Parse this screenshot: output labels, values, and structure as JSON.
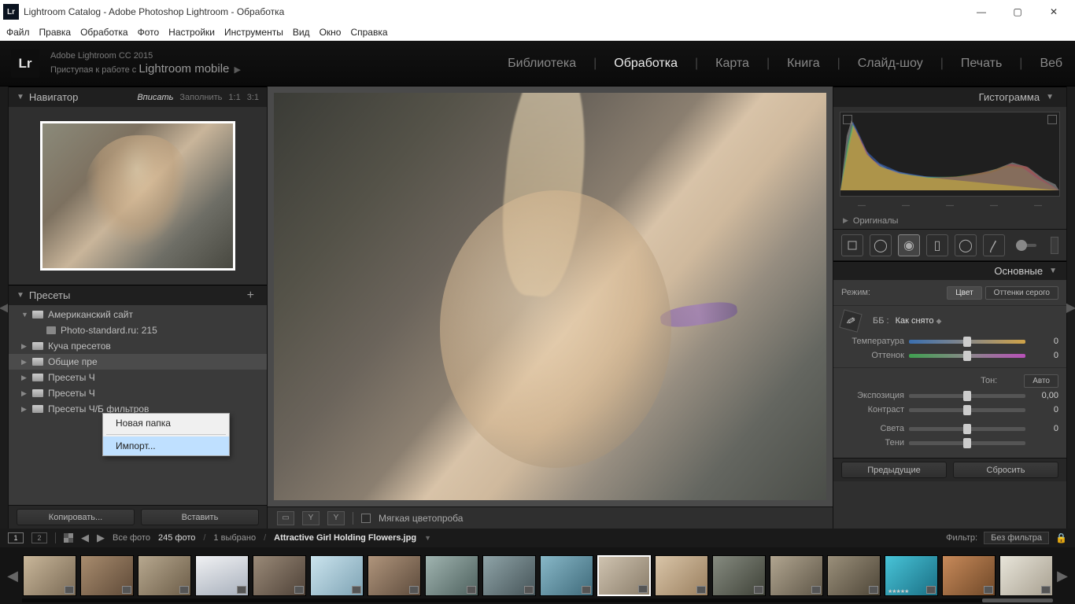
{
  "window": {
    "title": "Lightroom Catalog - Adobe Photoshop Lightroom - Обработка",
    "icon": "Lr"
  },
  "menubar": [
    "Файл",
    "Правка",
    "Обработка",
    "Фото",
    "Настройки",
    "Инструменты",
    "Вид",
    "Окно",
    "Справка"
  ],
  "brand": {
    "line1": "Adobe Lightroom CC 2015",
    "line2_pre": "Приступая к работе с ",
    "line2_big": "Lightroom mobile"
  },
  "modules": [
    "Библиотека",
    "Обработка",
    "Карта",
    "Книга",
    "Слайд-шоу",
    "Печать",
    "Веб"
  ],
  "modules_active_index": 1,
  "navigator": {
    "title": "Навигатор",
    "opts": [
      "Вписать",
      "Заполнить",
      "1:1",
      "3:1"
    ],
    "opts_sel": 0
  },
  "presets": {
    "title": "Пресеты",
    "tree": [
      {
        "label": "Американский сайт",
        "open": true
      },
      {
        "label": "Photo-standard.ru: 215",
        "sub": true
      },
      {
        "label": "Куча пресетов"
      },
      {
        "label": "Общие пре",
        "sel": true
      },
      {
        "label": "Пресеты Ч"
      },
      {
        "label": "Пресеты Ч"
      },
      {
        "label": "Пресеты Ч/Б фильтров"
      }
    ]
  },
  "ctxmenu": {
    "items": [
      "Новая папка",
      "Импорт..."
    ],
    "highlight_index": 1
  },
  "left_buttons": {
    "copy": "Копировать...",
    "paste": "Вставить"
  },
  "softproof": {
    "label": "Мягкая цветопроба"
  },
  "right_buttons": {
    "prev": "Предыдущие",
    "reset": "Сбросить"
  },
  "histogram": {
    "title": "Гистограмма"
  },
  "originals": "Оригиналы",
  "basic": {
    "title": "Основные",
    "mode_label": "Режим:",
    "mode_color": "Цвет",
    "mode_gray": "Оттенки серого",
    "wb_label": "ББ :",
    "wb_value": "Как снято",
    "temp_label": "Температура",
    "temp_val": "0",
    "tint_label": "Оттенок",
    "tint_val": "0",
    "tone_label": "Тон:",
    "tone_auto": "Авто",
    "exposure_label": "Экспозиция",
    "exposure_val": "0,00",
    "contrast_label": "Контраст",
    "contrast_val": "0",
    "highlights_label": "Света",
    "highlights_val": "0",
    "shadows_label": "Тени"
  },
  "info_strip": {
    "all_photos": "Все фото",
    "count": "245 фото",
    "selected": "1 выбрано",
    "filename": "Attractive Girl Holding Flowers.jpg",
    "filter_label": "Фильтр:",
    "filter_value": "Без фильтра",
    "screens": [
      "1",
      "2"
    ]
  },
  "filmstrip": {
    "selected_index": 10,
    "starred_index": 15,
    "count": 18
  },
  "thumb_colors": [
    "linear-gradient(135deg,#c9b79a,#7a6a55)",
    "linear-gradient(135deg,#a88c6e,#5f4a38)",
    "linear-gradient(135deg,#b7a88f,#6c5d48)",
    "linear-gradient(160deg,#f0f1f3,#a8b0bc)",
    "linear-gradient(135deg,#9a8a78,#4f4238)",
    "linear-gradient(135deg,#cbe4ee,#7ea3b4)",
    "linear-gradient(135deg,#b0957c,#5d4b3c)",
    "linear-gradient(135deg,#a0b4b0,#4e615e)",
    "linear-gradient(135deg,#8fa4a8,#465458)",
    "linear-gradient(135deg,#88b8c8,#3f6a7a)",
    "linear-gradient(135deg,#cfc3b0,#8a7d6a)",
    "linear-gradient(135deg,#d9c5a8,#9a7f5f)",
    "linear-gradient(135deg,#868b80,#3f4238)",
    "linear-gradient(135deg,#b1a590,#5f5748)",
    "linear-gradient(135deg,#9a8f7a,#4e4638)",
    "linear-gradient(135deg,#48c4d8,#1a6f84)",
    "linear-gradient(135deg,#c88a5a,#6f4828)",
    "linear-gradient(135deg,#e8e5da,#a8a090)"
  ]
}
